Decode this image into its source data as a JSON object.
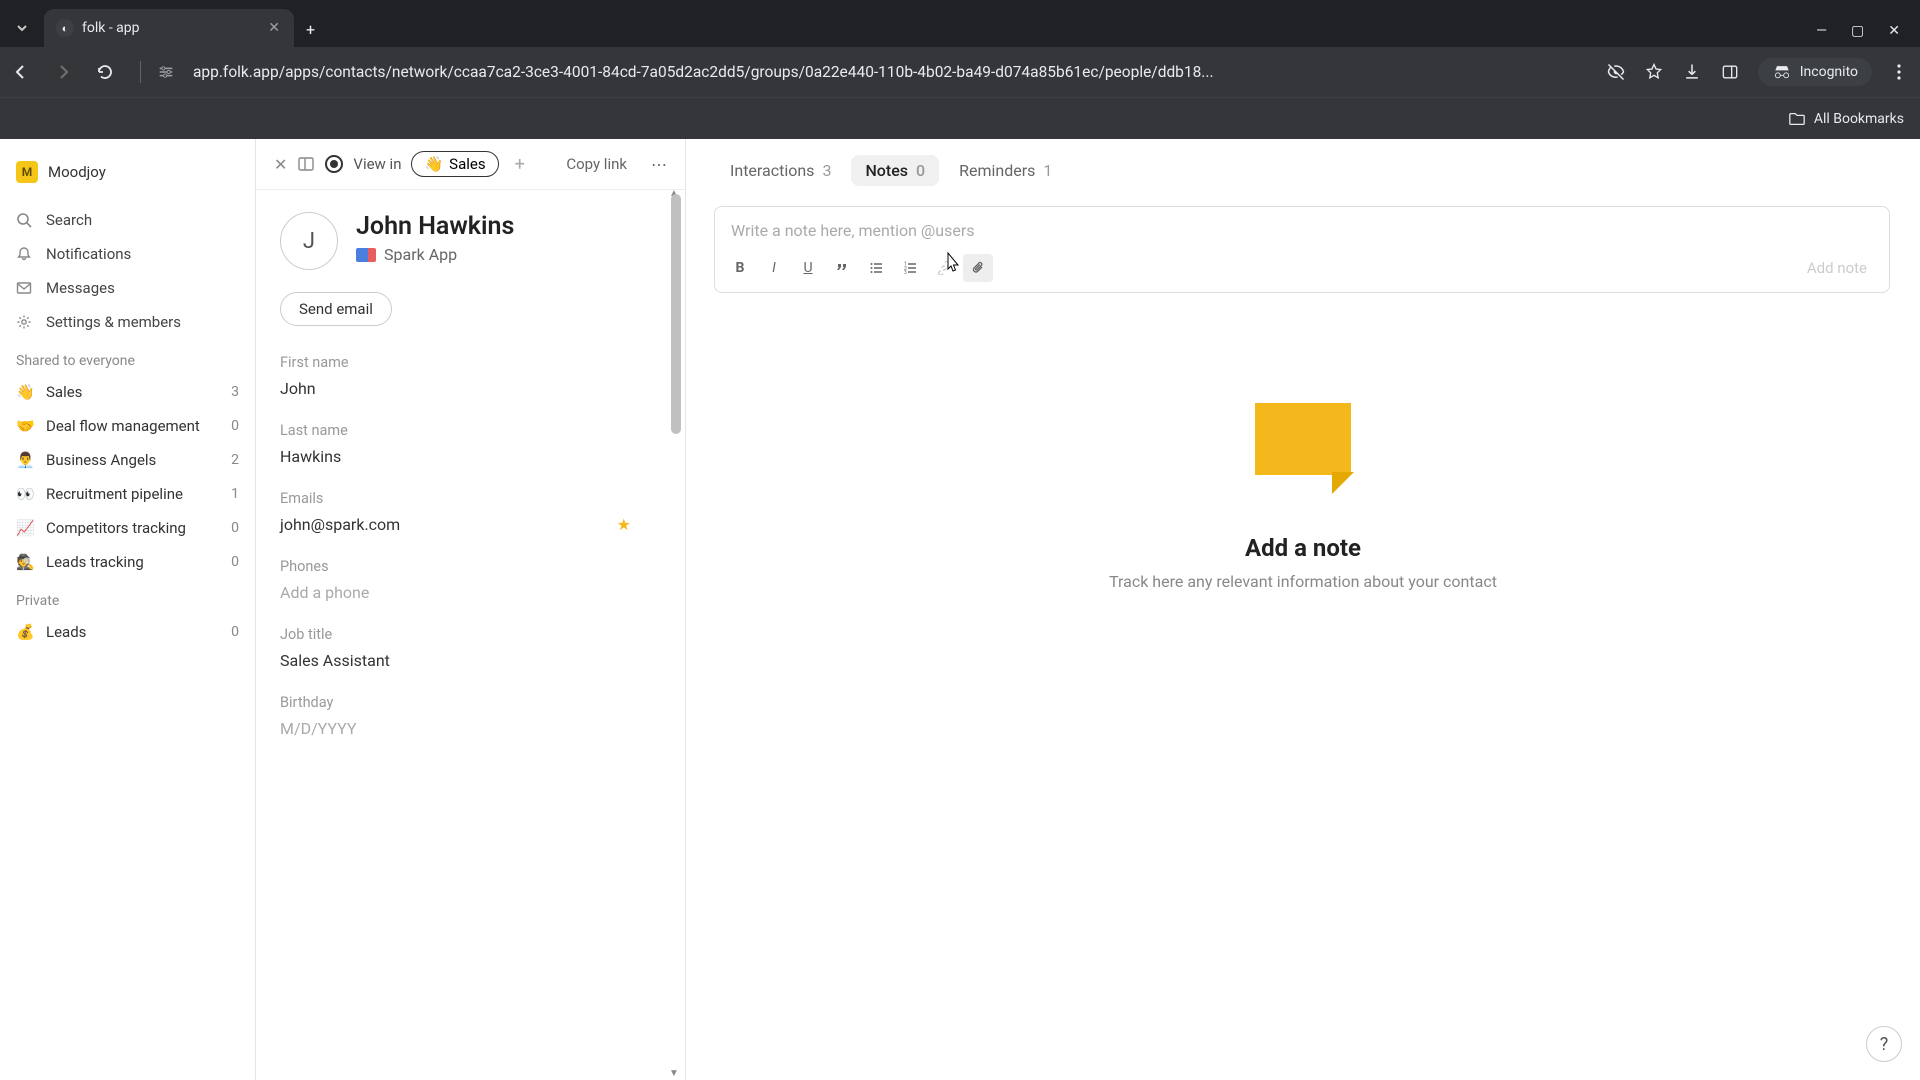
{
  "browser": {
    "tab_title": "folk - app",
    "url": "app.folk.app/apps/contacts/network/ccaa7ca2-3ce3-4001-84cd-7a05d2ac2dd5/groups/0a22e440-110b-4b02-ba49-d074a85b61ec/people/ddb18...",
    "bookmarks_label": "All Bookmarks",
    "incognito_label": "Incognito"
  },
  "sidebar": {
    "workspace": "Moodjoy",
    "nav": [
      {
        "icon": "🔍",
        "label": "Search"
      },
      {
        "icon": "🔔",
        "label": "Notifications"
      },
      {
        "icon": "✉",
        "label": "Messages"
      },
      {
        "icon": "⚙",
        "label": "Settings & members"
      }
    ],
    "shared_label": "Shared to everyone",
    "shared_groups": [
      {
        "emoji": "👋",
        "label": "Sales",
        "count": "3"
      },
      {
        "emoji": "🤝",
        "label": "Deal flow management",
        "count": "0"
      },
      {
        "emoji": "👨‍💼",
        "label": "Business Angels",
        "count": "2"
      },
      {
        "emoji": "👀",
        "label": "Recruitment pipeline",
        "count": "1"
      },
      {
        "emoji": "📈",
        "label": "Competitors tracking",
        "count": "0"
      },
      {
        "emoji": "🕵️",
        "label": "Leads tracking",
        "count": "0"
      }
    ],
    "private_label": "Private",
    "private_groups": [
      {
        "emoji": "💰",
        "label": "Leads",
        "count": "0"
      }
    ]
  },
  "detail": {
    "view_in_label": "View in",
    "chip_emoji": "👋",
    "chip_label": "Sales",
    "copy_link": "Copy link",
    "avatar_letter": "J",
    "contact_name": "John Hawkins",
    "company": "Spark App",
    "send_email": "Send email",
    "fields": {
      "first_name_label": "First name",
      "first_name": "John",
      "last_name_label": "Last name",
      "last_name": "Hawkins",
      "emails_label": "Emails",
      "email": "john@spark.com",
      "phones_label": "Phones",
      "phones_placeholder": "Add a phone",
      "job_label": "Job title",
      "job": "Sales Assistant",
      "birthday_label": "Birthday",
      "birthday_placeholder": "M/D/YYYY"
    }
  },
  "right": {
    "tabs": [
      {
        "label": "Interactions",
        "count": "3"
      },
      {
        "label": "Notes",
        "count": "0"
      },
      {
        "label": "Reminders",
        "count": "1"
      }
    ],
    "note_placeholder": "Write a note here, mention @users",
    "add_note": "Add note",
    "empty_title": "Add a note",
    "empty_subtitle": "Track here any relevant information about your contact"
  }
}
